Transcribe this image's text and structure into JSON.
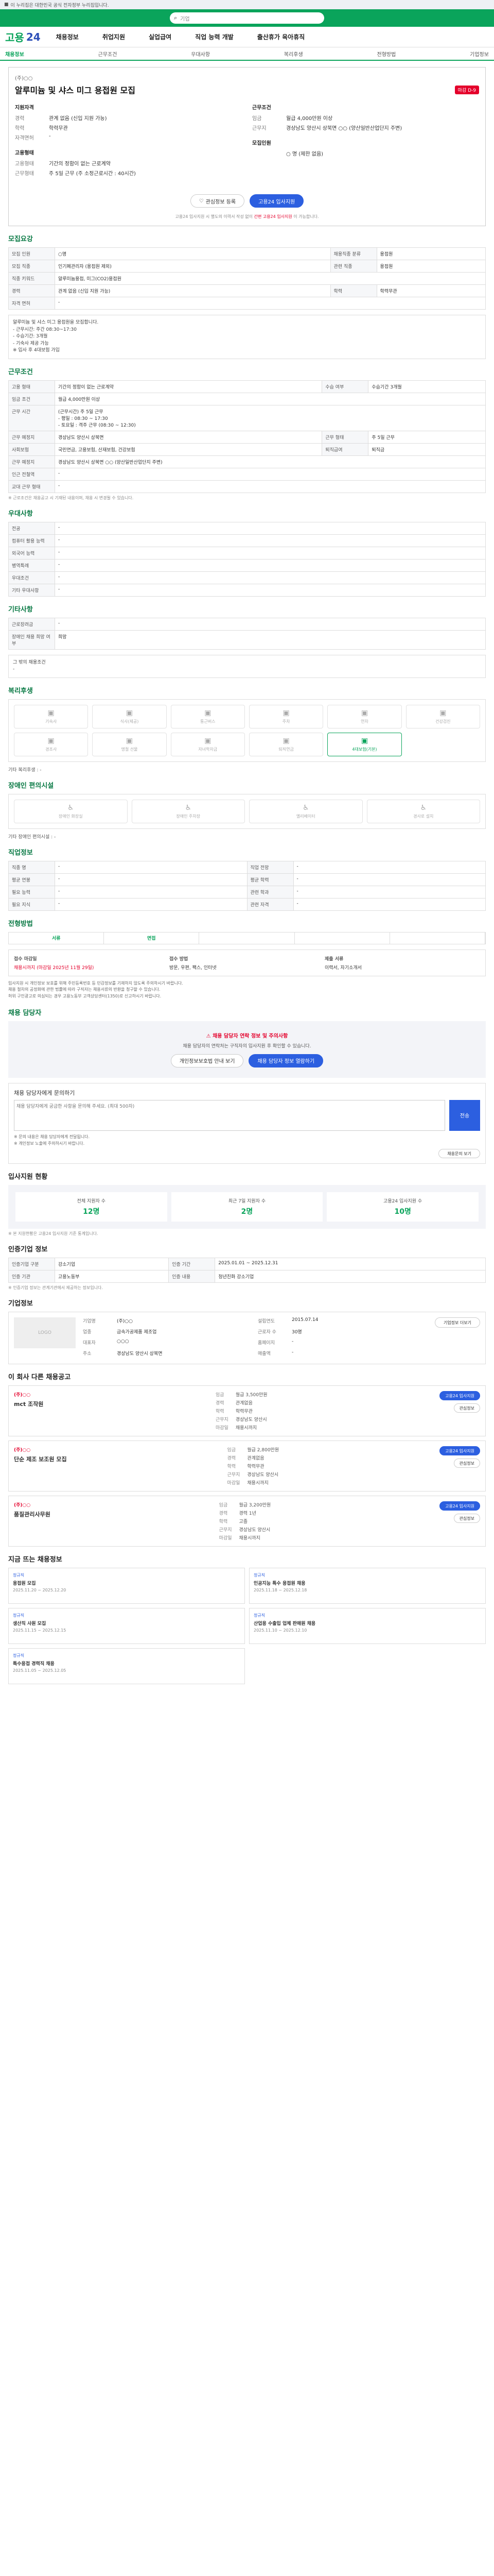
{
  "gov_bar": {
    "text": "이 누리집은 대한민국 공식 전자정부 누리집입니다."
  },
  "search": {
    "placeholder": "기업"
  },
  "brand": {
    "logo1": "고용",
    "logo2": "24",
    "nav": [
      "채용정보",
      "취업지원",
      "실업급여",
      "직업 능력 개발",
      "출산휴가 육아휴직"
    ]
  },
  "tabs": [
    "채용정보",
    "근무조건",
    "우대사항",
    "복리후생",
    "전형방법",
    "기업정보"
  ],
  "job": {
    "company": "(주)○○",
    "title": "알루미늄 및 샤스 미그 용접원 모집",
    "badge": "마감 D-9",
    "left_title": "지원자격",
    "left": [
      {
        "k": "경력",
        "v": "관계 없음 (신입 지원 가능)"
      },
      {
        "k": "학력",
        "v": "학력무관"
      },
      {
        "k": "자격면허",
        "v": "-"
      }
    ],
    "left2_title": "고용형태",
    "left2": [
      {
        "k": "고용형태",
        "v": "기간의 정함이 없는 근로계약"
      },
      {
        "k": "근무형태",
        "v": "주 5일 근무 (주 소정근로시간 : 40시간)"
      }
    ],
    "right_title": "근무조건",
    "right": [
      {
        "k": "임금",
        "v": "월급 4,000만원 이상"
      },
      {
        "k": "근무지",
        "v": "경상남도 양산시 상북면 ○○ (양산일반산업단지 주변)"
      }
    ],
    "right2_title": "모집인원",
    "right2": [
      {
        "k": "",
        "v": "○ 명 (제한 없음)"
      }
    ]
  },
  "actions": {
    "save": "관심정보 등록",
    "apply": "고용24 입사지원"
  },
  "notice": {
    "text": "고용24 입사지원 시 별도의 이력서 작성 없이",
    "highlight": "간편 고용24 입사지원",
    "tail": "이 가능합니다."
  },
  "sections": {
    "recruit": "모집요강",
    "conditions": "근무조건",
    "preference": "우대사항",
    "others": "기타사항",
    "welfare": "복리후생",
    "disabled": "장애인 편의시설",
    "job_info": "직업정보",
    "process": "전형방법",
    "inquiry": "채용 담당자",
    "stats": "입사지원 현황",
    "company_info": "인증기업 정보",
    "company": "기업정보",
    "similar": "이 회사 다른 채용공고",
    "popular": "지금 뜨는 채용정보"
  },
  "recruit_table": [
    {
      "k": "모집 인원",
      "v": "○명",
      "k2": "채용직종 분류",
      "v2": "용접원"
    },
    {
      "k": "모집 직종",
      "v": "인기폐관리자 (용접원 제외)",
      "k2": "관련 직종",
      "v2": "용접원"
    },
    {
      "k": "직종 키워드",
      "v": "알루미늄용접, 미그(CO2)용접원",
      "k2": "",
      "v2": ""
    },
    {
      "k": "경력",
      "v": "관계 없음 (신입 지원 가능)",
      "k2": "학력",
      "v2": "학력무관"
    },
    {
      "k": "자격 면허",
      "v": "-",
      "k2": "",
      "v2": ""
    }
  ],
  "recruit_desc": "알루미늄 및 샤스 미그 용접원을 모집합니다.\n- 근무시간: 주간 08:30~17:30\n- 수습기간: 3개월\n- 기숙사 제공 가능\n※ 입사 후 4대보험 가입",
  "conditions_table": [
    {
      "k": "고용 형태",
      "v": "기간의 정함이 없는 근로계약",
      "k2": "수습 여부",
      "v2": "수습기간 3개월"
    },
    {
      "k": "임금 조건",
      "v": "월급 4,000만원 이상"
    },
    {
      "k": "근무 시간",
      "v": "(근무시간) 주 5일 근무\n- 평일 : 08:30 ~ 17:30\n- 토요일 : 격주 근무 (08:30 ~ 12:30)"
    },
    {
      "k": "근무 예정지",
      "v": "경상남도 양산시 상북면",
      "k2": "근무 형태",
      "v2": "주 5일 근무"
    },
    {
      "k": "사회보험",
      "v": "국민연금, 고용보험, 산재보험, 건강보험",
      "k2": "퇴직급여",
      "v2": "퇴직금"
    },
    {
      "k": "근무 예정지",
      "v": "경상남도 양산시 상북면 ○○ (양산일반산업단지 주변)",
      "k2": "",
      "v2": ""
    },
    {
      "k": "인근 전철역",
      "v": "-",
      "k2": "",
      "v2": ""
    },
    {
      "k": "교대 근무 형태",
      "v": "-",
      "k2": "",
      "v2": ""
    }
  ],
  "conditions_note": "※ 근로조건은 채용공고 시 기재된 내용이며, 채용 시 변경될 수 있습니다.",
  "preference_table": [
    {
      "k": "전공",
      "v": "-"
    },
    {
      "k": "컴퓨터 활용 능력",
      "v": "-"
    },
    {
      "k": "외국어 능력",
      "v": "-"
    },
    {
      "k": "병역특례",
      "v": "-"
    },
    {
      "k": "우대조건",
      "v": "-"
    },
    {
      "k": "기타 우대사항",
      "v": "-"
    }
  ],
  "others_table": [
    {
      "k": "근로장려금",
      "v": "-"
    },
    {
      "k": "장애인 채용 희망 여부",
      "v": "희망"
    }
  ],
  "others_desc": "그 밖의 채용조건\n-",
  "welfare_items": [
    {
      "label": "기숙사",
      "on": false
    },
    {
      "label": "식사(제공)",
      "on": false
    },
    {
      "label": "통근버스",
      "on": false
    },
    {
      "label": "주차",
      "on": false
    },
    {
      "label": "연차",
      "on": false
    },
    {
      "label": "건강검진",
      "on": false
    },
    {
      "label": "경조사",
      "on": false
    },
    {
      "label": "명절 선물",
      "on": false
    },
    {
      "label": "자녀학자금",
      "on": false
    },
    {
      "label": "퇴직연금",
      "on": false
    },
    {
      "label": "4대보험(기본)",
      "on": true
    }
  ],
  "welfare_more": "기타 복리후생 : -",
  "disabled_items": [
    "장애인 화장실",
    "장애인 주차장",
    "엘리베이터",
    "경사로 설치"
  ],
  "disabled_more": "기타 장애인 편의시설 : -",
  "job_info_table": [
    {
      "k": "직종 명",
      "v": "-",
      "k2": "직업 전망",
      "v2": "-"
    },
    {
      "k": "평균 연봉",
      "v": "-",
      "k2": "평균 학력",
      "v2": "-"
    },
    {
      "k": "필요 능력",
      "v": "-",
      "k2": "관련 학과",
      "v2": "-"
    },
    {
      "k": "필요 지식",
      "v": "-",
      "k2": "관련 자격",
      "v2": "-"
    }
  ],
  "process_steps": [
    "서류",
    "면접",
    "",
    "",
    ""
  ],
  "apply_box": {
    "label1": "접수 마감일",
    "value1": "채용시까지 (마감일 2025년 11월 29일)",
    "label2": "접수 방법",
    "value2": "방문, 우편, 팩스, 인터넷",
    "label3": "제출 서류",
    "value3": "이력서, 자기소개서"
  },
  "process_bullets": [
    "입사지원 시 개인정보 보호를 위해 주민등록번호 등 민감정보를 기재하지 않도록 주의하시기 바랍니다.",
    "채용 절차의 공정화에 관한 법률에 따라 구직자는 채용서류의 반환을 청구할 수 있습니다.",
    "허위 구인광고로 의심되는 경우 고용노동부 고객상담센터(1350)로 신고하시기 바랍니다."
  ],
  "warn": {
    "title": "채용 담당자 연락 정보 및 주의사항",
    "text": "채용 담당자의 연락처는 구직자의 입사지원 후 확인할 수 있습니다.",
    "btn1": "개인정보보호법 안내 보기",
    "btn2": "채용 담당자 정보 열람하기"
  },
  "inquiry": {
    "label": "채용 담당자에게 문의하기",
    "placeholder": "채용 담당자에게 궁금한 사항을 문의해 주세요. (최대 500자)",
    "send": "전송",
    "notes": [
      "※ 문의 내용은 채용 담당자에게 전달됩니다.",
      "※ 개인정보 노출에 주의하시기 바랍니다."
    ],
    "link": "채용문의 보기"
  },
  "stats": [
    {
      "label": "전체 지원자 수",
      "value": "12명"
    },
    {
      "label": "최근 7일 지원자 수",
      "value": "2명"
    },
    {
      "label": "고용24 입사지원 수",
      "value": "10명"
    }
  ],
  "stats_note": "※ 본 지원현황은 고용24 입사지원 기준 통계입니다.",
  "company_cert": [
    {
      "k": "인증기업 구분",
      "v": "강소기업",
      "k2": "인증 기간",
      "v2": "2025.01.01 ~ 2025.12.31"
    },
    {
      "k": "인증 기관",
      "v": "고용노동부",
      "k2": "인증 내용",
      "v2": "청년친화 강소기업"
    }
  ],
  "company_cert_note": "※ 인증기업 정보는 관계기관에서 제공하는 정보입니다.",
  "company_box": {
    "logo": "LOGO",
    "info": [
      {
        "k": "기업명",
        "v": "(주)○○"
      },
      {
        "k": "설립연도",
        "v": "2015.07.14"
      },
      {
        "k": "업종",
        "v": "금속가공제품 제조업"
      },
      {
        "k": "근로자 수",
        "v": "30명"
      },
      {
        "k": "대표자",
        "v": "○○○"
      },
      {
        "k": "홈페이지",
        "v": "-"
      },
      {
        "k": "주소",
        "v": "경상남도 양산시 상북면"
      },
      {
        "k": "매출액",
        "v": "-"
      }
    ],
    "btn": "기업정보 더보기"
  },
  "similar_jobs": [
    {
      "company": "(주)○○",
      "title": "mct 조작원",
      "wage": "월급 3,500만원",
      "career": "관계없음",
      "edu": "학력무관",
      "place": "경상남도 양산시",
      "deadline": "채용시까지"
    },
    {
      "company": "(주)○○",
      "title": "단순 제조 보조원 모집",
      "wage": "월급 2,800만원",
      "career": "관계없음",
      "edu": "학력무관",
      "place": "경상남도 양산시",
      "deadline": "채용시까지"
    },
    {
      "company": "(주)○○",
      "title": "품질관리사무원",
      "wage": "월급 3,200만원",
      "career": "경력 1년",
      "edu": "고졸",
      "place": "경상남도 양산시",
      "deadline": "채용시까지"
    }
  ],
  "similar_labels": {
    "wage": "임금",
    "career": "경력",
    "edu": "학력",
    "place": "근무지",
    "deadline": "마감일",
    "btn1": "고용24 입사지원",
    "btn2": "관심정보"
  },
  "popular": [
    {
      "tag": "정규직",
      "title": "용접원 모집",
      "period": "2025.11.20 ~ 2025.12.20"
    },
    {
      "tag": "정규직",
      "title": "인공지능 특수 용접원 채용",
      "period": "2025.11.18 ~ 2025.12.18"
    },
    {
      "tag": "정규직",
      "title": "생산직 사원 모집",
      "period": "2025.11.15 ~ 2025.12.15"
    },
    {
      "tag": "정규직",
      "title": "산업용 수출입 업체 판매원 채용",
      "period": "2025.11.10 ~ 2025.12.10"
    },
    {
      "tag": "정규직",
      "title": "특수용접 경력직 채용",
      "period": "2025.11.05 ~ 2025.12.05"
    }
  ]
}
